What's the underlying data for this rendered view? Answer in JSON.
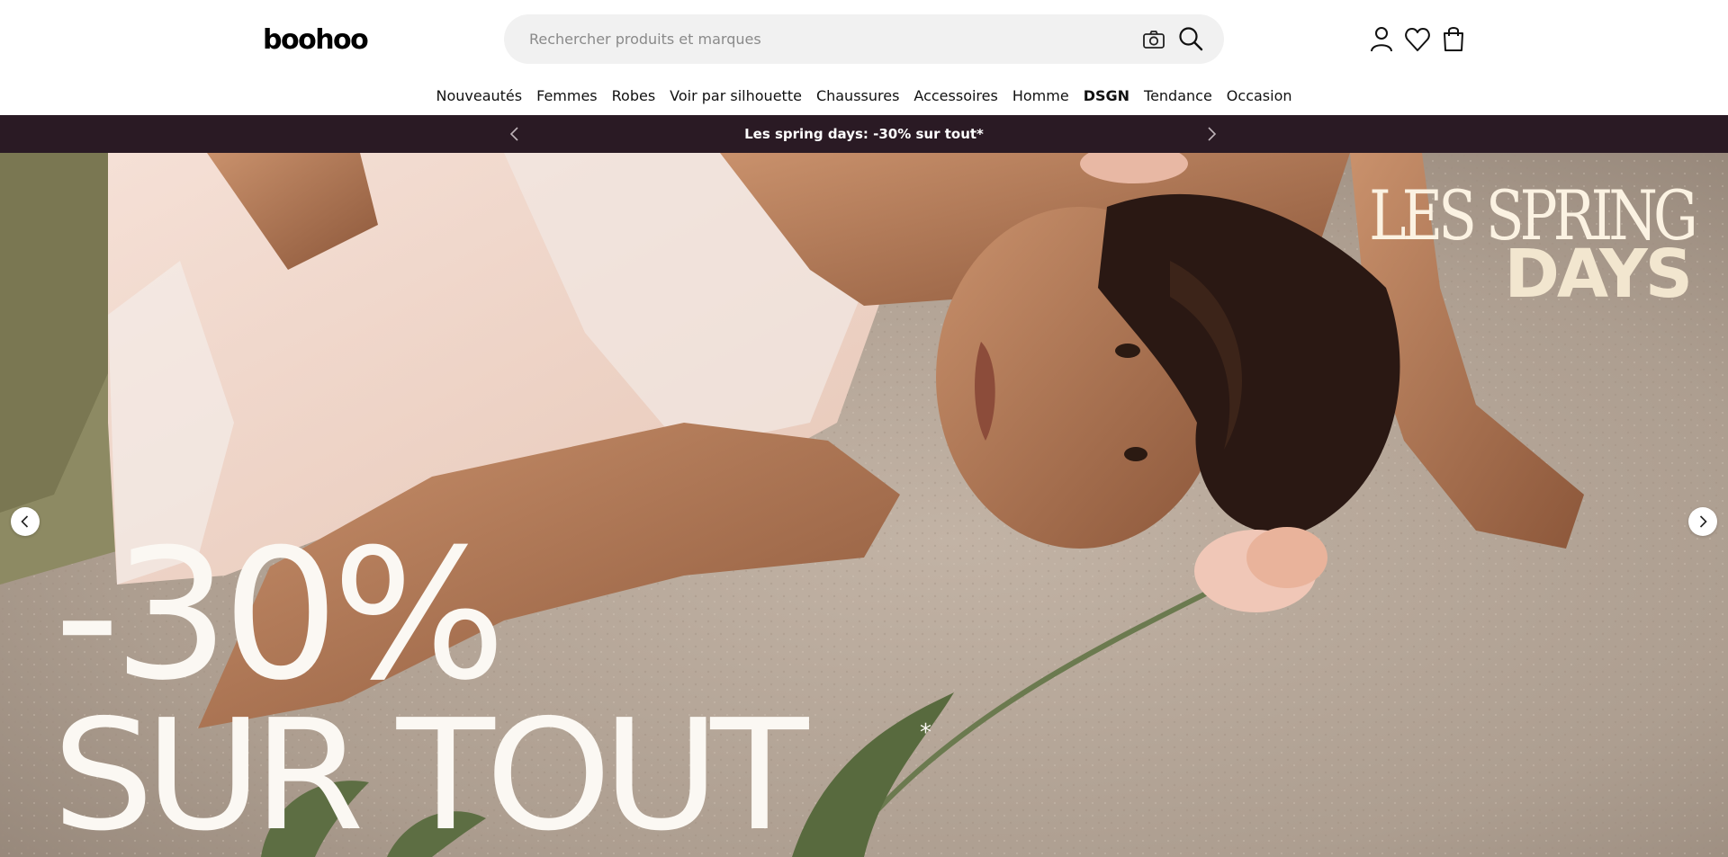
{
  "header": {
    "logo_text": "boohoo",
    "search": {
      "placeholder": "Rechercher produits et marques",
      "camera_icon": "camera-icon",
      "search_icon": "search-icon"
    },
    "icons": [
      "user-icon",
      "heart-icon",
      "bag-icon"
    ]
  },
  "nav": {
    "items": [
      {
        "label": "Nouveautés"
      },
      {
        "label": "Femmes"
      },
      {
        "label": "Robes"
      },
      {
        "label": "Voir par silhouette"
      },
      {
        "label": "Chaussures"
      },
      {
        "label": "Accessoires"
      },
      {
        "label": "Homme"
      },
      {
        "label": "DSGN"
      },
      {
        "label": "Tendance"
      },
      {
        "label": "Occasion"
      }
    ]
  },
  "promo_bar": {
    "text": "Les spring days: -30% sur tout*",
    "background": "#2a1a24"
  },
  "hero": {
    "headline_line1": "LES SPRING",
    "headline_line2": "DAYS",
    "discount": "-30%",
    "discount_sub": "SUR TOUT",
    "asterisk": "*"
  }
}
